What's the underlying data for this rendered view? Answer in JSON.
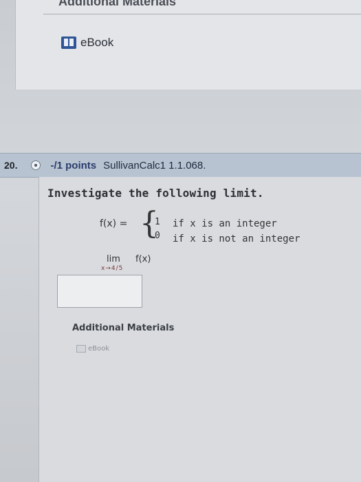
{
  "previous": {
    "additional_materials_title": "Additional Materials",
    "ebook_label": "eBook"
  },
  "question": {
    "number": "20.",
    "points": "-/1 points",
    "reference": "SullivanCalc1 1.1.068.",
    "prompt": "Investigate the following limit.",
    "function_lhs": "f(x) =",
    "cases": [
      {
        "value": "1",
        "condition": "if x is an integer"
      },
      {
        "value": "0",
        "condition": "if x is not an integer"
      }
    ],
    "limit_text": "lim",
    "limit_function": "f(x)",
    "limit_subscript": "x→4/5",
    "answer_value": "",
    "additional_materials_label": "Additional Materials",
    "ebook_label": "eBook"
  }
}
